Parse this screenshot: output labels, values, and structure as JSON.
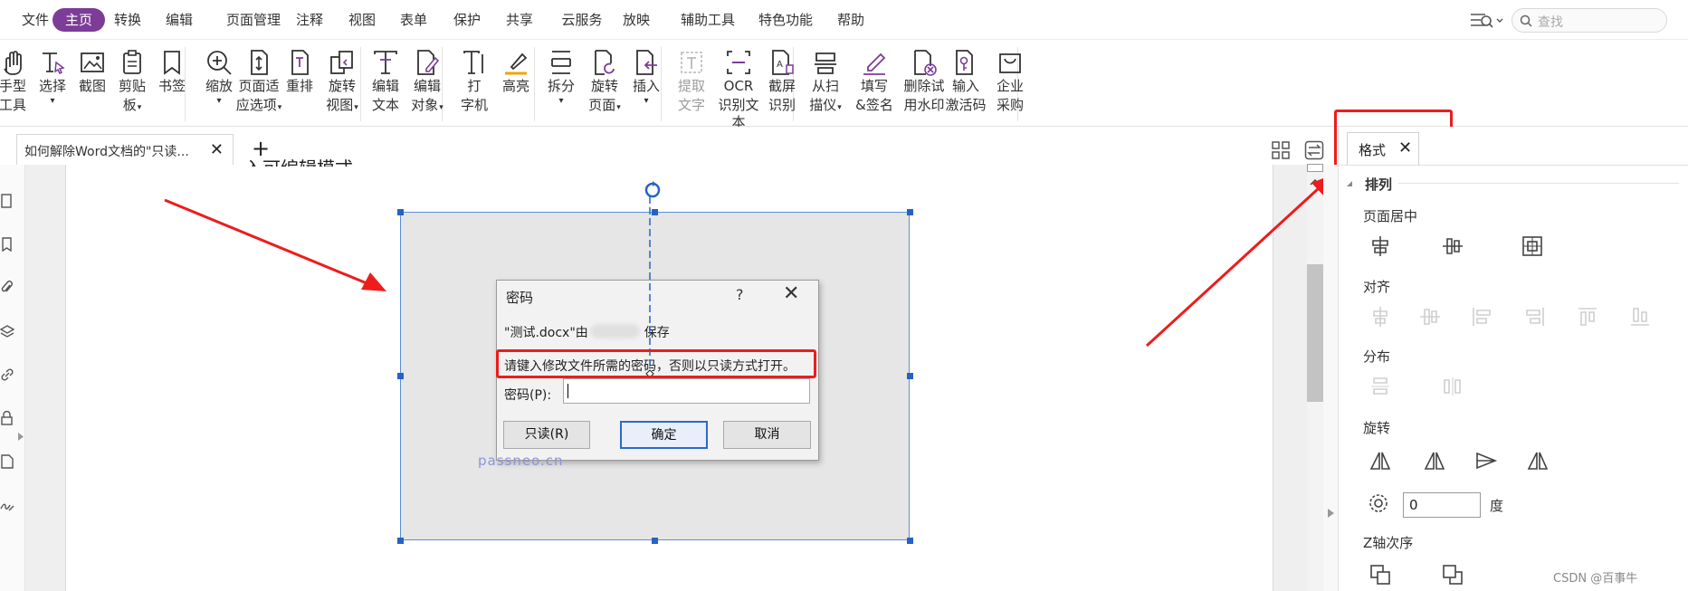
{
  "menu": {
    "items": [
      "文件",
      "主页",
      "转换",
      "编辑",
      "页面管理",
      "注释",
      "视图",
      "表单",
      "保护",
      "共享",
      "云服务",
      "放映",
      "辅助工具",
      "特色功能",
      "帮助"
    ],
    "active": "主页"
  },
  "search": {
    "placeholder": "查找"
  },
  "ribbon": {
    "tools": [
      {
        "label": "手型\n工具",
        "icon": "hand-icon"
      },
      {
        "label": "选择",
        "icon": "select-text-icon",
        "dd": true
      },
      {
        "label": "截图",
        "icon": "screenshot-icon"
      },
      {
        "label": "剪贴\n板",
        "icon": "clipboard-icon",
        "dd": true
      },
      {
        "label": "书签",
        "icon": "bookmark-icon"
      },
      {
        "label": "缩放",
        "icon": "zoom-icon",
        "dd": true
      },
      {
        "label": "页面适\n应选项",
        "icon": "fit-page-icon",
        "dd": true
      },
      {
        "label": "重排",
        "icon": "reflow-icon"
      },
      {
        "label": "旋转\n视图",
        "icon": "rotate-view-icon",
        "dd": true
      },
      {
        "label": "编辑\n文本",
        "icon": "edit-text-icon"
      },
      {
        "label": "编辑\n对象",
        "icon": "edit-object-icon",
        "dd": true
      },
      {
        "label": "打\n字机",
        "icon": "typewriter-icon"
      },
      {
        "label": "高亮",
        "icon": "highlight-icon"
      },
      {
        "label": "拆分",
        "icon": "split-icon",
        "dd": true
      },
      {
        "label": "旋转\n页面",
        "icon": "rotate-page-icon",
        "dd": true
      },
      {
        "label": "插入",
        "icon": "insert-icon",
        "dd": true
      },
      {
        "label": "提取\n文字",
        "icon": "extract-text-icon",
        "disabled": true
      },
      {
        "label": "OCR\n识别文本",
        "icon": "ocr-icon"
      },
      {
        "label": "截屏\n识别",
        "icon": "screen-ocr-icon"
      },
      {
        "label": "从扫\n描仪",
        "icon": "scanner-icon",
        "dd": true
      },
      {
        "label": "填写\n&签名",
        "icon": "sign-icon"
      },
      {
        "label": "删除试\n用水印",
        "icon": "remove-watermark-icon"
      },
      {
        "label": "输入\n激活码",
        "icon": "activation-icon"
      },
      {
        "label": "企业\n采购",
        "icon": "enterprise-icon"
      }
    ]
  },
  "tabs": {
    "doc": "如何解除Word文档的\"只读...",
    "add": "+"
  },
  "doc": {
    "top_text": "入可编辑模式。"
  },
  "dialog": {
    "title": "密码",
    "help": "?",
    "close": "✕",
    "line1_a": "\"测试.docx\"由",
    "line1_b": "保存",
    "line2": "请键入修改文件所需的密码，否则以只读方式打开。",
    "pwd_label": "密码(P):",
    "btn_readonly": "只读(R)",
    "btn_ok": "确定",
    "btn_cancel": "取消"
  },
  "watermark": "passneo.cn",
  "panel": {
    "tab": "格式",
    "close": "✕",
    "section": "排列",
    "page_center": "页面居中",
    "align": "对齐",
    "distribute": "分布",
    "rotate": "旋转",
    "rotation_value": "0",
    "degree": "度",
    "zorder": "Z轴次序"
  },
  "footer": {
    "csdn": "CSDN @百事牛"
  },
  "colors": {
    "accent": "#7d3c98",
    "annotation_red": "#ee1c1c",
    "selection": "#2463c6"
  }
}
